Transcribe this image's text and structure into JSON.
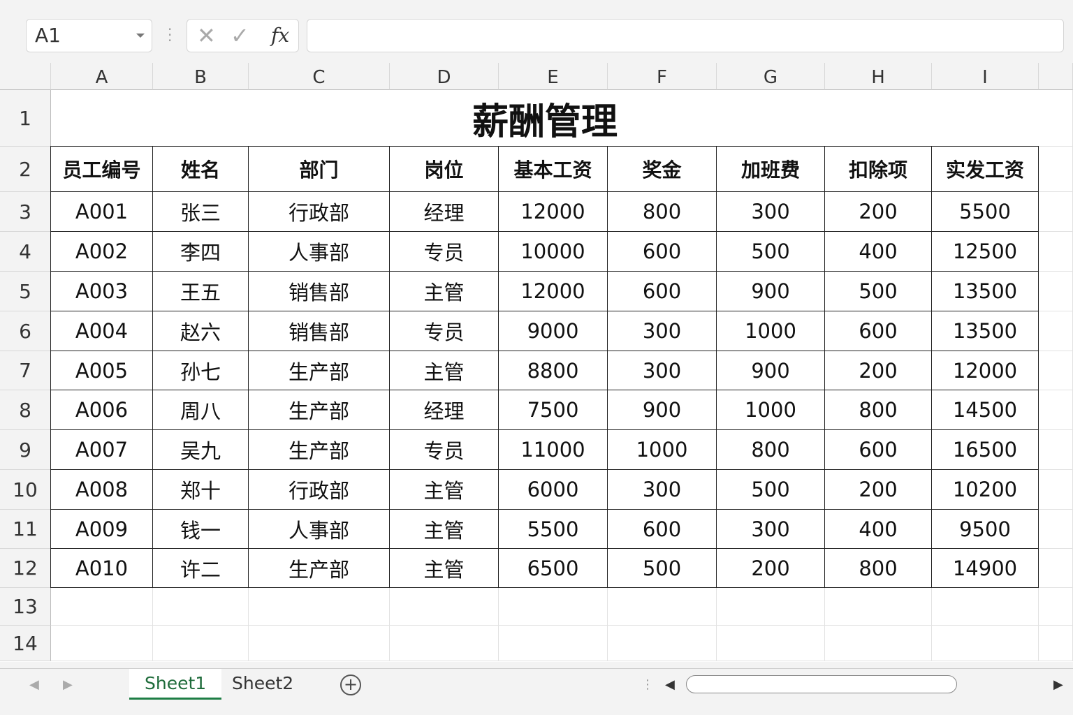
{
  "formula_bar": {
    "name_box": "A1",
    "cancel_icon": "✕",
    "enter_icon": "✓",
    "fx_label": "fx",
    "formula": ""
  },
  "columns": [
    "A",
    "B",
    "C",
    "D",
    "E",
    "F",
    "G",
    "H",
    "I"
  ],
  "rows": [
    "1",
    "2",
    "3",
    "4",
    "5",
    "6",
    "7",
    "8",
    "9",
    "10",
    "11",
    "12",
    "13",
    "14"
  ],
  "title": "薪酬管理",
  "headers": [
    "员工编号",
    "姓名",
    "部门",
    "岗位",
    "基本工资",
    "奖金",
    "加班费",
    "扣除项",
    "实发工资"
  ],
  "table": [
    [
      "A001",
      "张三",
      "行政部",
      "经理",
      "12000",
      "800",
      "300",
      "200",
      "5500"
    ],
    [
      "A002",
      "李四",
      "人事部",
      "专员",
      "10000",
      "600",
      "500",
      "400",
      "12500"
    ],
    [
      "A003",
      "王五",
      "销售部",
      "主管",
      "12000",
      "600",
      "900",
      "500",
      "13500"
    ],
    [
      "A004",
      "赵六",
      "销售部",
      "专员",
      "9000",
      "300",
      "1000",
      "600",
      "13500"
    ],
    [
      "A005",
      "孙七",
      "生产部",
      "主管",
      "8800",
      "300",
      "900",
      "200",
      "12000"
    ],
    [
      "A006",
      "周八",
      "生产部",
      "经理",
      "7500",
      "900",
      "1000",
      "800",
      "14500"
    ],
    [
      "A007",
      "吴九",
      "生产部",
      "专员",
      "11000",
      "1000",
      "800",
      "600",
      "16500"
    ],
    [
      "A008",
      "郑十",
      "行政部",
      "主管",
      "6000",
      "300",
      "500",
      "200",
      "10200"
    ],
    [
      "A009",
      "钱一",
      "人事部",
      "主管",
      "5500",
      "600",
      "300",
      "400",
      "9500"
    ],
    [
      "A010",
      "许二",
      "生产部",
      "主管",
      "6500",
      "500",
      "200",
      "800",
      "14900"
    ]
  ],
  "sheets": [
    "Sheet1",
    "Sheet2"
  ],
  "add_sheet": "+"
}
